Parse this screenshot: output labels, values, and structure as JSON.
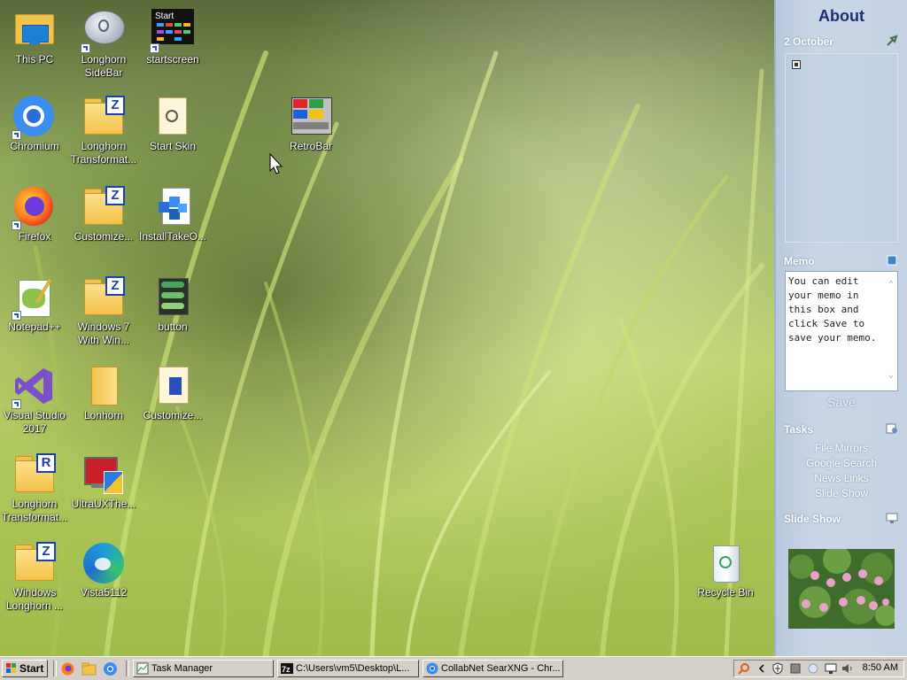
{
  "desktop": {
    "icons": [
      {
        "label": "This PC",
        "icon": "this-pc-icon"
      },
      {
        "label": "Longhorn SideBar",
        "icon": "longhorn-sidebar-icon"
      },
      {
        "label": "startscreen",
        "icon": "startscreen-icon"
      },
      {
        "label": "Chromium",
        "icon": "chromium-icon"
      },
      {
        "label": "Longhorn Transformat...",
        "icon": "zip-folder-icon"
      },
      {
        "label": "Start Skin",
        "icon": "start-skin-icon"
      },
      {
        "label": "RetroBar",
        "icon": "retrobar-icon"
      },
      {
        "label": "Firefox",
        "icon": "firefox-icon"
      },
      {
        "label": "Customize...",
        "icon": "zip-folder-icon"
      },
      {
        "label": "InstallTakeO...",
        "icon": "install-takeown-icon"
      },
      {
        "label": "Notepad++",
        "icon": "notepadpp-icon"
      },
      {
        "label": "Windows 7 With Win...",
        "icon": "zip-folder-icon"
      },
      {
        "label": "button",
        "icon": "button-image-icon"
      },
      {
        "label": "Visual Studio 2017",
        "icon": "visual-studio-icon"
      },
      {
        "label": "Lonhorn",
        "icon": "folder-icon"
      },
      {
        "label": "Customize...",
        "icon": "customize-file-icon"
      },
      {
        "label": "Longhorn Transformat...",
        "icon": "rar-folder-icon"
      },
      {
        "label": "UltraUXThe...",
        "icon": "ultrauxtheme-icon"
      },
      {
        "label": "Windows Longhorn ...",
        "icon": "zip-folder-icon"
      },
      {
        "label": "Vista5112",
        "icon": "edge-icon"
      },
      {
        "label": "Recycle Bin",
        "icon": "recycle-bin-icon"
      }
    ],
    "badge_z": "Z",
    "badge_r": "R",
    "startscreen_caption": "Start"
  },
  "sidebar": {
    "title": "About",
    "calendar_date": "2 October",
    "memo_heading": "Memo",
    "memo_text": "You can edit your memo in this box and click Save to save your memo.",
    "save_label": "Save",
    "tasks_heading": "Tasks",
    "tasks": [
      "File Mirrors",
      "Google Search",
      "News Links",
      "Slide Show"
    ],
    "slideshow_heading": "Slide Show"
  },
  "taskbar": {
    "start_label": "Start",
    "windows": [
      {
        "label": "Task Manager",
        "icon": "task-manager-icon"
      },
      {
        "label": "C:\\Users\\vm5\\Desktop\\L...",
        "icon": "7zip-icon"
      },
      {
        "label": "CollabNet SearXNG - Chr...",
        "icon": "chromium-icon"
      }
    ],
    "clock": "8:50 AM"
  },
  "colors": {
    "sidebar_title": "#1e2f73",
    "taskbar": "#d4d0c8",
    "zip_badge": "#1a3fb3"
  }
}
